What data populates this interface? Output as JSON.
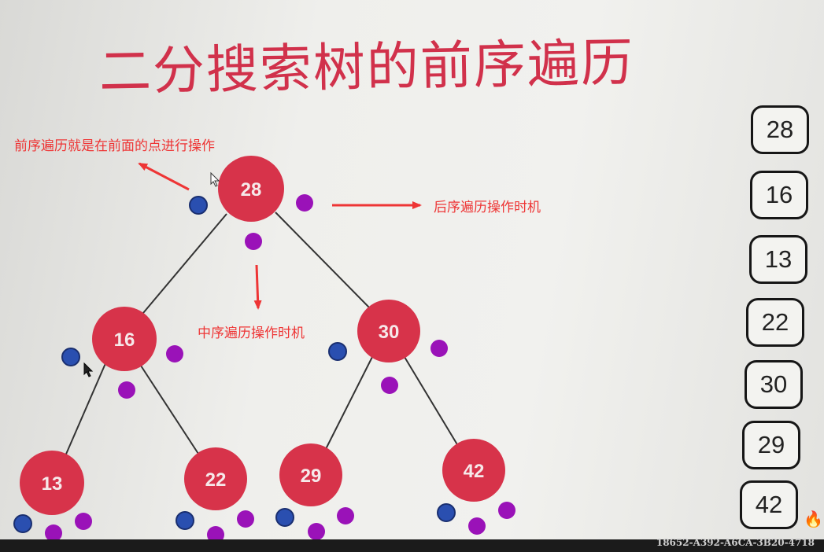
{
  "title": "二分搜索树的前序遍历",
  "annotations": {
    "preorder": "前序遍历就是在前面的点进行操作",
    "postorder": "后序遍历操作时机",
    "inorder": "中序遍历操作时机"
  },
  "tree": {
    "nodes": [
      {
        "id": "n28",
        "label": "28"
      },
      {
        "id": "n16",
        "label": "16"
      },
      {
        "id": "n30",
        "label": "30"
      },
      {
        "id": "n13",
        "label": "13"
      },
      {
        "id": "n22",
        "label": "22"
      },
      {
        "id": "n29",
        "label": "29"
      },
      {
        "id": "n42",
        "label": "42"
      }
    ],
    "edges": [
      [
        "n28",
        "n16"
      ],
      [
        "n28",
        "n30"
      ],
      [
        "n16",
        "n13"
      ],
      [
        "n16",
        "n22"
      ],
      [
        "n30",
        "n29"
      ],
      [
        "n30",
        "n42"
      ]
    ]
  },
  "sequence": [
    "28",
    "16",
    "13",
    "22",
    "30",
    "29",
    "42"
  ],
  "watermark": "18652-A392-A6CA-3B20-4718",
  "colors": {
    "node": "#d7334a",
    "title": "#d1314b",
    "annotation": "#ee3535",
    "preorder_dot": "#2a4fb0",
    "visit_dot": "#9a12b8",
    "arrow": "#ee3535"
  }
}
